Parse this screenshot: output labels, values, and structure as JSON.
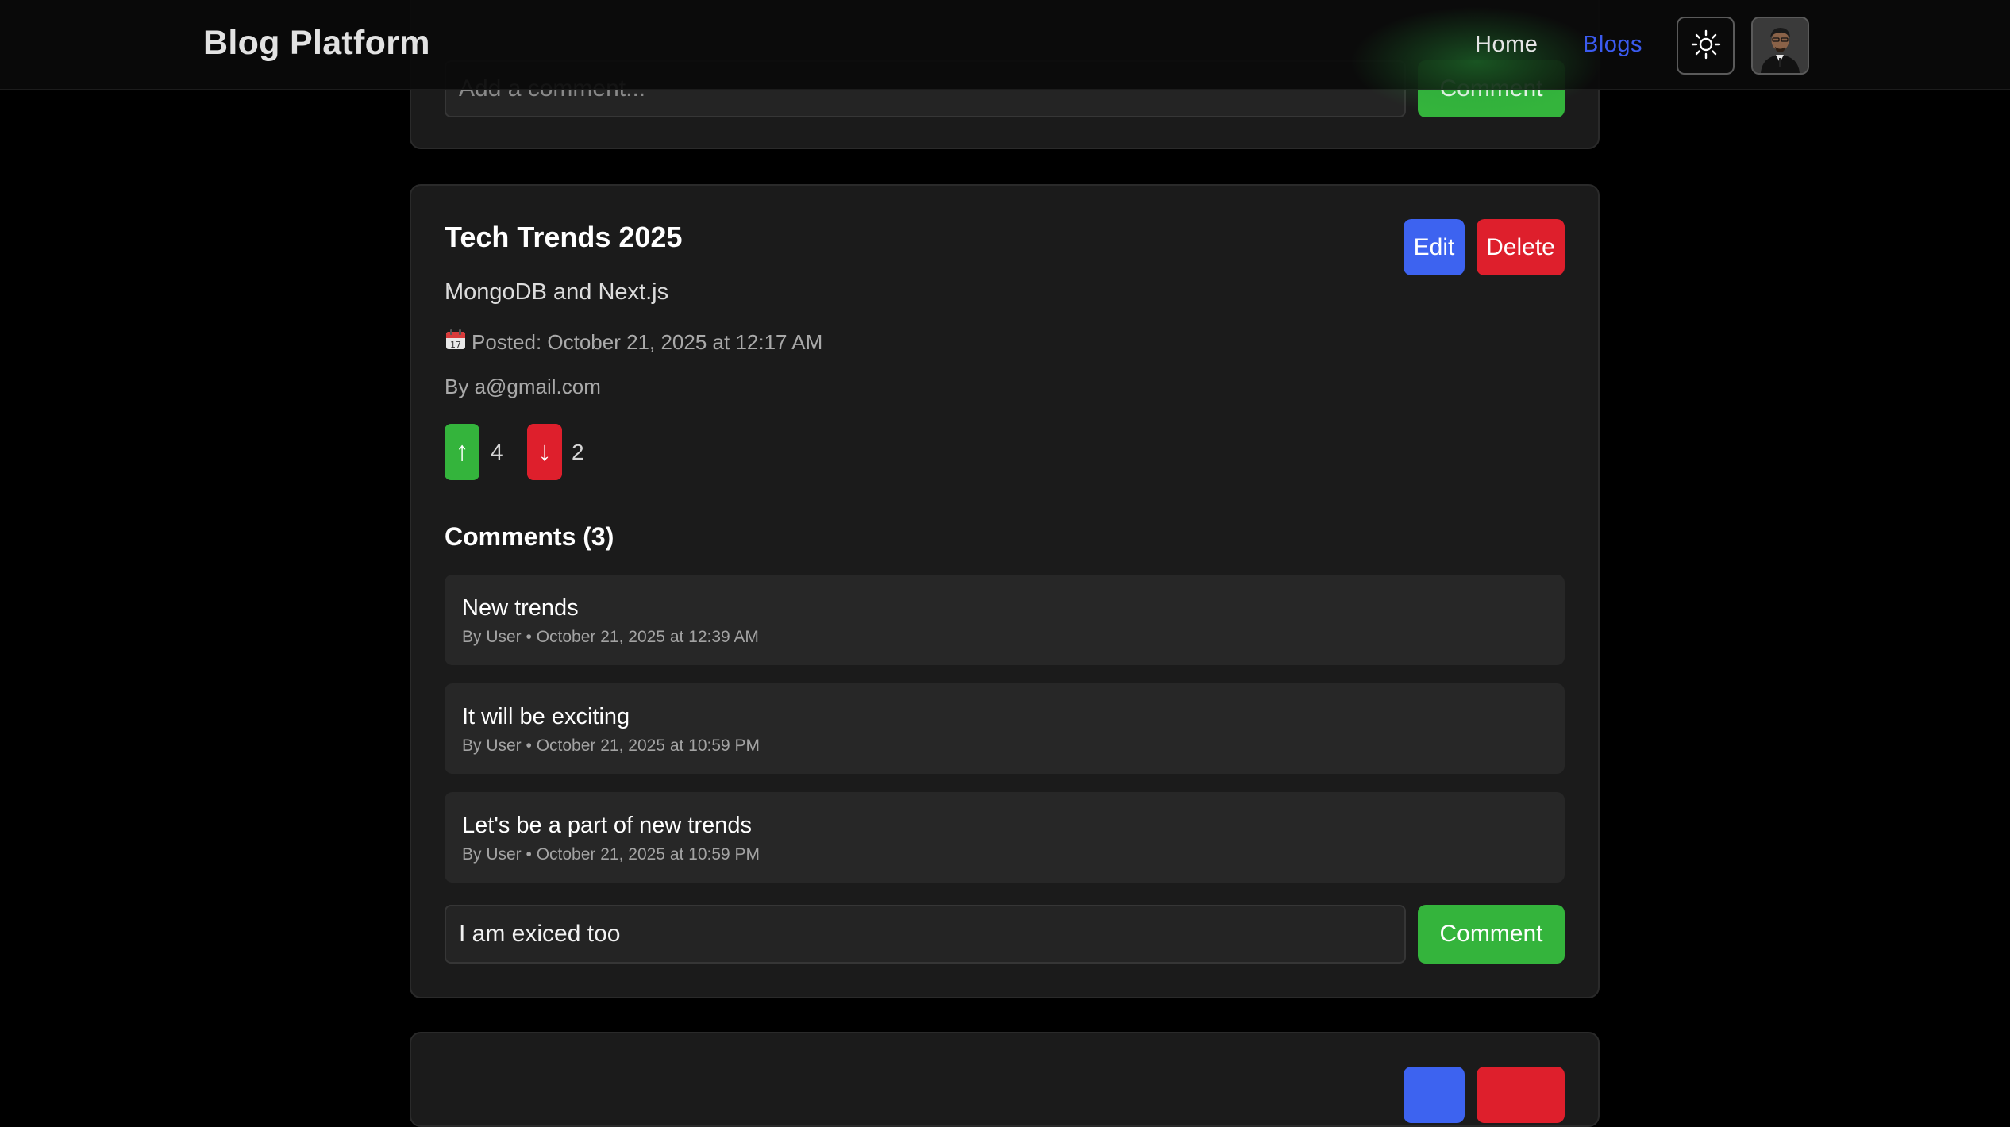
{
  "nav": {
    "brand": "Blog Platform",
    "links": [
      {
        "label": "Home",
        "active": false
      },
      {
        "label": "Blogs",
        "active": true
      }
    ],
    "theme_icon": "sun-icon",
    "accent_color": "#3b5bf0"
  },
  "previous_post": {
    "comment_placeholder": "Add a comment...",
    "comment_button": "Comment"
  },
  "post": {
    "title": "Tech Trends 2025",
    "subtitle": "MongoDB and Next.js",
    "date_icon": "calendar-icon",
    "posted": "Posted: October 21, 2025 at 12:17 AM",
    "author": "By a@gmail.com",
    "edit_label": "Edit",
    "delete_label": "Delete",
    "upvote_icon": "↑",
    "downvote_icon": "↓",
    "upvotes": "4",
    "downvotes": "2",
    "comments_heading": "Comments (3)",
    "comments": [
      {
        "text": "New trends",
        "meta": "By User • October 21, 2025 at 12:39 AM"
      },
      {
        "text": "It will be exciting",
        "meta": "By User • October 21, 2025 at 10:59 PM"
      },
      {
        "text": "Let's be a part of new trends",
        "meta": "By User • October 21, 2025 at 10:59 PM"
      }
    ],
    "comment_input_value": "I am exiced too",
    "comment_button": "Comment"
  },
  "colors": {
    "green": "#34b43c",
    "blue": "#3d63f0",
    "red": "#de1f2c"
  }
}
